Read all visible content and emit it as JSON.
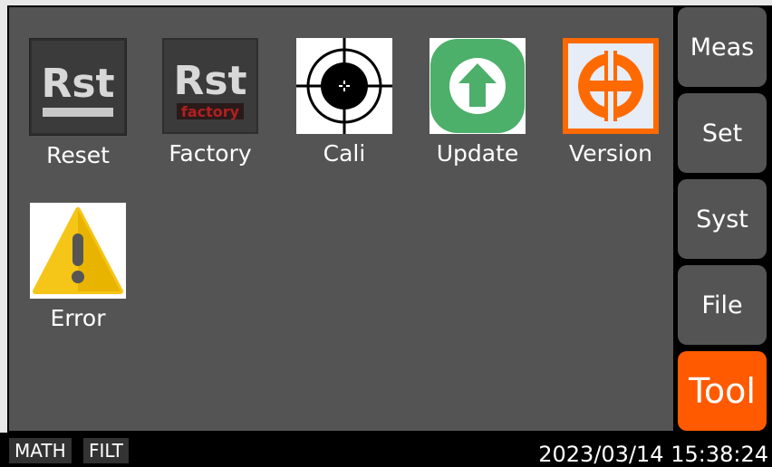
{
  "apps": [
    {
      "id": "reset",
      "label": "Reset",
      "icon": "reset-icon",
      "text": "Rst"
    },
    {
      "id": "factory",
      "label": "Factory",
      "icon": "factory-reset-icon",
      "text": "Rst",
      "subtext": "factory"
    },
    {
      "id": "cali",
      "label": "Cali",
      "icon": "crosshair-icon"
    },
    {
      "id": "update",
      "label": "Update",
      "icon": "upload-arrow-icon"
    },
    {
      "id": "version",
      "label": "Version",
      "icon": "version-icon"
    },
    {
      "id": "error",
      "label": "Error",
      "icon": "warning-icon"
    }
  ],
  "sidebar": {
    "items": [
      {
        "label": "Meas"
      },
      {
        "label": "Set"
      },
      {
        "label": "Syst"
      },
      {
        "label": "File"
      },
      {
        "label": "Tool",
        "active": true
      }
    ]
  },
  "status": {
    "badges": [
      "MATH",
      "FILT"
    ],
    "datetime": "2023/03/14 15:38:24"
  },
  "colors": {
    "background": "#545454",
    "accent": "#ff5a00",
    "update_green": "#4caf6a",
    "warning_yellow": "#f5c518"
  }
}
